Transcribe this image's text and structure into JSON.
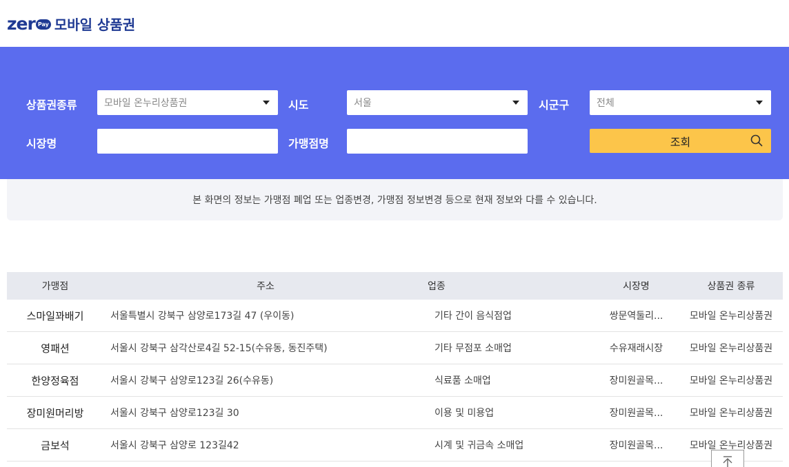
{
  "header": {
    "logo_main": "zer",
    "logo_pay": "Pay",
    "title": "모바일 상품권"
  },
  "search": {
    "voucher_type_label": "상품권종류",
    "voucher_type_value": "모바일 온누리상품권",
    "sido_label": "시도",
    "sido_value": "서울",
    "sigungu_label": "시군구",
    "sigungu_value": "전체",
    "market_label": "시장명",
    "market_value": "",
    "store_label": "가맹점명",
    "store_value": "",
    "search_button": "조회"
  },
  "notice": "본 화면의 정보는 가맹점 폐업 또는 업종변경, 가맹점 정보변경 등으로 현재 정보와 다를 수 있습니다.",
  "table": {
    "headers": [
      "가맹점",
      "주소",
      "업종",
      "시장명",
      "상품권 종류"
    ],
    "rows": [
      {
        "store": "스마일꽈배기",
        "address": "서울특별시 강북구 삼양로173길 47 (우이동)",
        "category": "기타 간이 음식점업",
        "market": "쌍문역둘리...",
        "voucher": "모바일 온누리상품권"
      },
      {
        "store": "영패션",
        "address": "서울시 강북구 삼각산로4길 52-15(수유동, 동진주택)",
        "category": "기타 무점포 소매업",
        "market": "수유재래시장",
        "voucher": "모바일 온누리상품권"
      },
      {
        "store": "한양정육점",
        "address": "서울시 강북구 삼양로123길 26(수유동)",
        "category": "식료품 소매업",
        "market": "장미원골목...",
        "voucher": "모바일 온누리상품권"
      },
      {
        "store": "장미원머리방",
        "address": "서울시 강북구 삼양로123길 30",
        "category": "이용 및 미용업",
        "market": "장미원골목...",
        "voucher": "모바일 온누리상품권"
      },
      {
        "store": "금보석",
        "address": "서울시 강북구 삼양로 123길42",
        "category": "시계 및 귀금속 소매업",
        "market": "장미원골목...",
        "voucher": "모바일 온누리상품권"
      }
    ]
  },
  "colors": {
    "brand": "#1f3a93",
    "panel": "#5b6cee",
    "search_button": "#fcc54a"
  }
}
